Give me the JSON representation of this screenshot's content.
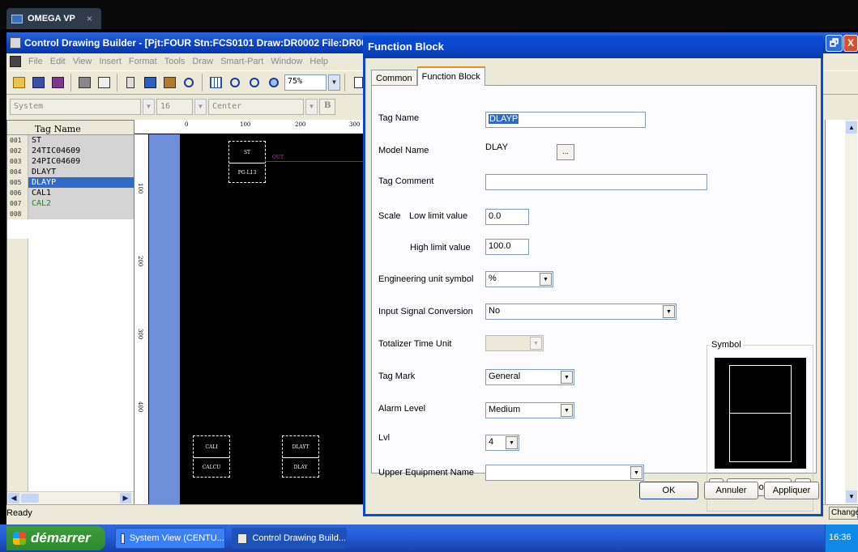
{
  "remote_tab": {
    "title": "OMEGA VP",
    "close": "×"
  },
  "app": {
    "title": "Control Drawing Builder - [Pjt:FOUR Stn:FCS0101 Draw:DR0002 File:DR00",
    "menu": [
      "File",
      "Edit",
      "View",
      "Insert",
      "Format",
      "Tools",
      "Draw",
      "Smart-Part",
      "Window",
      "Help"
    ],
    "zoom": "75%",
    "font_combo": "System",
    "size_combo": "16",
    "align_combo": "Center",
    "bold_label": "B",
    "restore_glyph": "🗗",
    "close_glyph": "X"
  },
  "taglist": {
    "header": "Tag Name",
    "rows": [
      {
        "num": "001",
        "name": "ST"
      },
      {
        "num": "002",
        "name": "24TIC04609"
      },
      {
        "num": "003",
        "name": "24PIC04609"
      },
      {
        "num": "004",
        "name": "DLAYT"
      },
      {
        "num": "005",
        "name": "DLAYP"
      },
      {
        "num": "006",
        "name": "CAL1"
      },
      {
        "num": "007",
        "name": "CAL2"
      },
      {
        "num": "008",
        "name": ""
      }
    ]
  },
  "drawing": {
    "ruler_top": [
      "0",
      "100",
      "200",
      "300"
    ],
    "ruler_left": [
      "100",
      "200",
      "300",
      "400"
    ],
    "blocks": [
      {
        "top": "ST",
        "bottom": "PG-L13"
      },
      {
        "top": "CALI",
        "bottom": "CALCU"
      },
      {
        "top": "DLAYT",
        "bottom": "DLAY"
      }
    ],
    "out_label": "OUT"
  },
  "statusbar": {
    "text": "Ready",
    "right": "Change"
  },
  "taskbar": {
    "start": "démarrer",
    "tasks": [
      "System View (CENTU...",
      "Control Drawing Build..."
    ],
    "clock": "16:36"
  },
  "dialog": {
    "title": "Function Block",
    "tabs": [
      "Common",
      "Function Block"
    ],
    "labels": {
      "tag_name": "Tag Name",
      "model_name": "Model Name",
      "tag_comment": "Tag Comment",
      "scale": "Scale",
      "low_limit": "Low limit value",
      "high_limit": "High limit value",
      "eng_unit": "Engineering unit symbol",
      "input_conv": "Input Signal Conversion",
      "totalizer": "Totalizer Time Unit",
      "tag_mark": "Tag Mark",
      "alarm_level": "Alarm Level",
      "lvl": "Lvl",
      "upper_equipment": "Upper Equipment Name",
      "symbol": "Symbol"
    },
    "values": {
      "tag_name": "DLAYP",
      "model_name": "DLAY",
      "tag_comment": "",
      "low_limit": "0.0",
      "high_limit": "100.0",
      "eng_unit": "%",
      "input_conv": "No",
      "totalizer": "",
      "tag_mark": "General",
      "alarm_level": "Medium",
      "lvl": "4",
      "upper_equipment": ""
    },
    "buttons": {
      "ellipsis": "...",
      "sym_prev": "<<",
      "symbol_list": "Symbol List",
      "sym_next": ">>",
      "ok": "OK",
      "cancel": "Annuler",
      "apply": "Appliquer"
    }
  }
}
